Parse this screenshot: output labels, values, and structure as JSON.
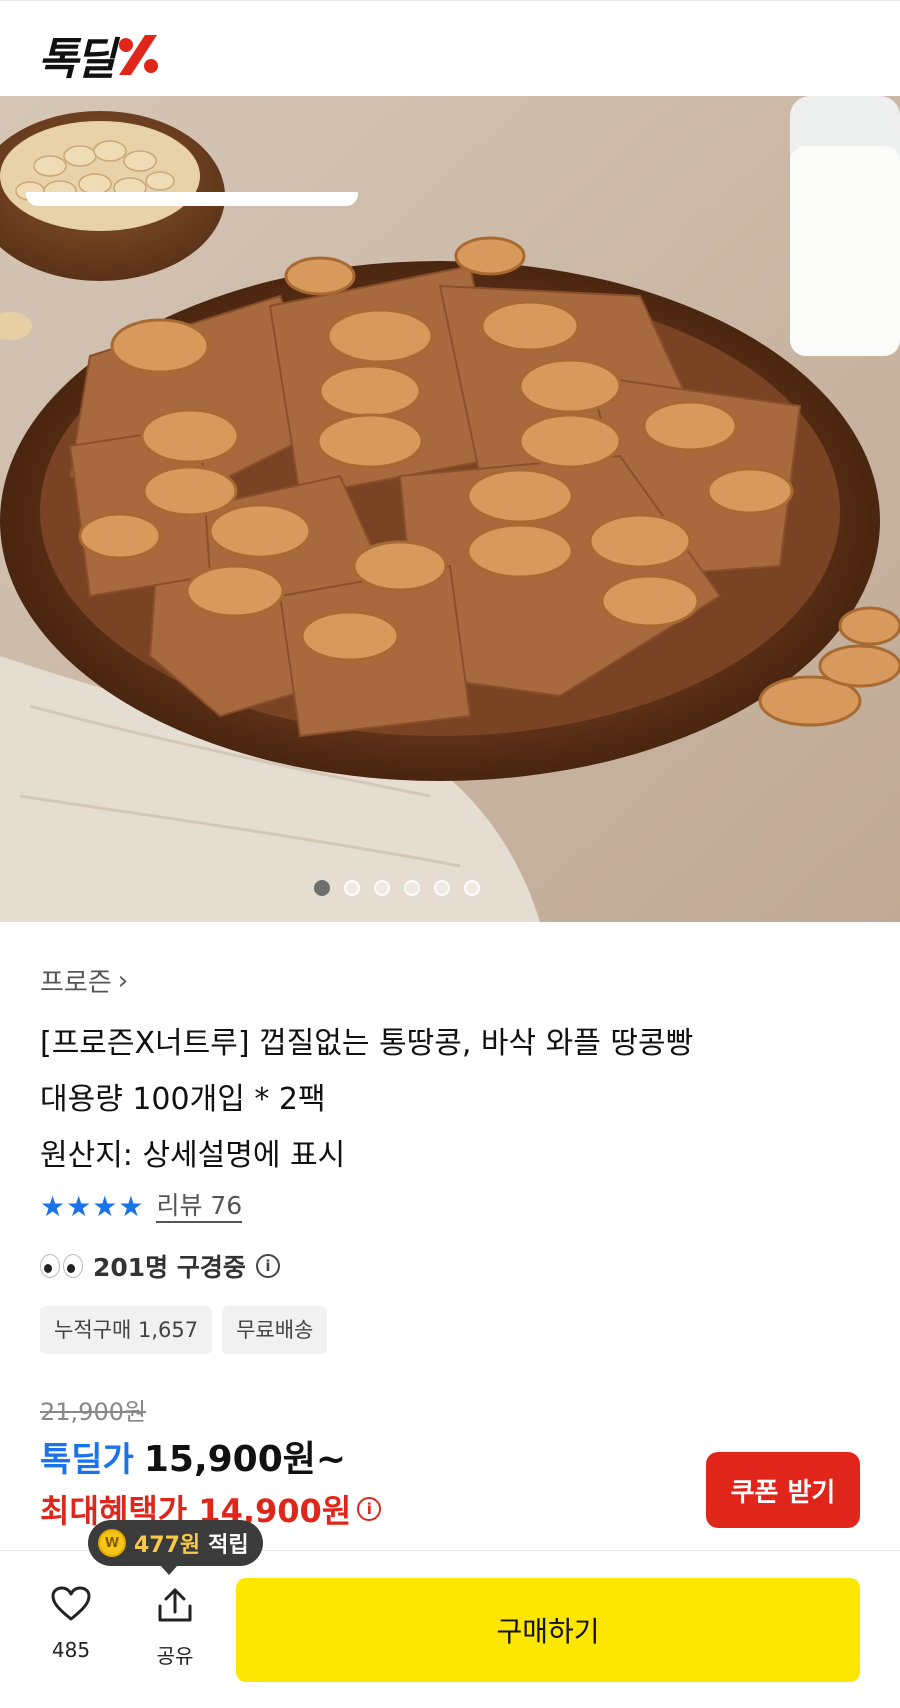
{
  "header": {
    "logo_text": "톡딜",
    "logo_mark_icon": "percent-slash-icon",
    "brand_color": "#e0261a"
  },
  "gallery": {
    "image_icon": "peanut-waffle-photo",
    "dot_count": 6,
    "active_index": 0
  },
  "product": {
    "category": "프로즌",
    "title_line1": "[프로즌X너트루] 껍질없는 통땅콩, 바삭 와플 땅콩빵",
    "title_line2": "대용량 100개입 * 2팩",
    "title_line3": "원산지: 상세설명에 표시",
    "rating_stars": 4,
    "review_label": "리뷰 76",
    "viewers_text": "201명 구경중",
    "chips": [
      "누적구매 1,657",
      "무료배송"
    ]
  },
  "price": {
    "original": "21,900원",
    "deal_label": "톡딜가",
    "deal_price": "15,900원~",
    "benefit_text": "최대혜택가 14,900원",
    "coupon_button": "쿠폰 받기",
    "accent_blue": "#1a73e8",
    "accent_red": "#e0261a"
  },
  "bottom_bar": {
    "reward_amount": "477원",
    "reward_suffix": "적립",
    "coin_symbol": "W",
    "like_count": "485",
    "share_label": "공유",
    "buy_button": "구매하기",
    "buy_color": "#fde600"
  }
}
